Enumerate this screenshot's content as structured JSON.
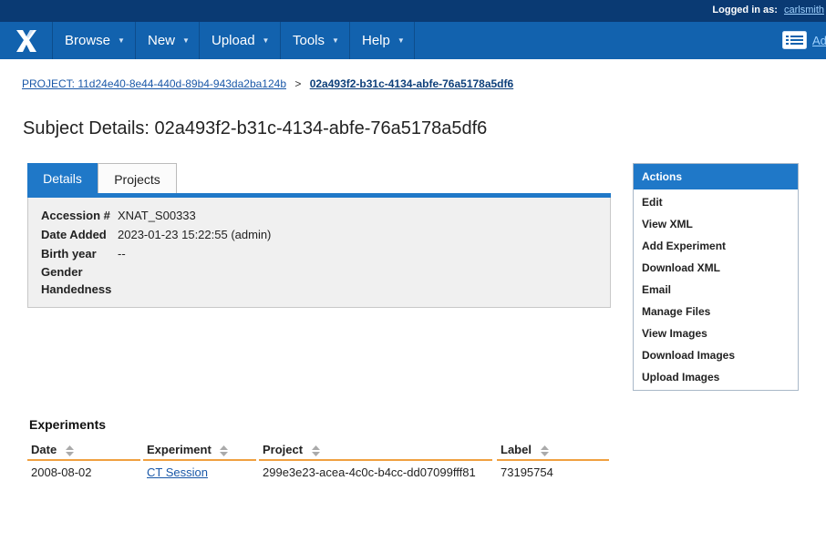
{
  "header": {
    "logged_in_label": "Logged in as:",
    "username": "carlsmith"
  },
  "nav": {
    "items": [
      {
        "label": "Browse"
      },
      {
        "label": "New"
      },
      {
        "label": "Upload"
      },
      {
        "label": "Tools"
      },
      {
        "label": "Help"
      }
    ],
    "right_label": "Ad"
  },
  "breadcrumb": {
    "project": "PROJECT: 11d24e40-8e44-440d-89b4-943da2ba124b",
    "separator": ">",
    "current": "02a493f2-b31c-4134-abfe-76a5178a5df6"
  },
  "page": {
    "title": "Subject Details: 02a493f2-b31c-4134-abfe-76a5178a5df6"
  },
  "tabs": {
    "details": "Details",
    "projects": "Projects"
  },
  "details": [
    {
      "label": "Accession #",
      "value": "XNAT_S00333"
    },
    {
      "label": "Date Added",
      "value": "2023-01-23 15:22:55 (admin)"
    },
    {
      "label": "Birth year",
      "value": "--"
    },
    {
      "label": "Gender",
      "value": ""
    },
    {
      "label": "Handedness",
      "value": ""
    }
  ],
  "actions": {
    "title": "Actions",
    "items": [
      "Edit",
      "View XML",
      "Add Experiment",
      "Download XML",
      "Email",
      "Manage Files",
      "View Images",
      "Download Images",
      "Upload Images"
    ]
  },
  "experiments": {
    "title": "Experiments",
    "columns": [
      "Date",
      "Experiment",
      "Project",
      "Label"
    ],
    "rows": [
      {
        "date": "2008-08-02",
        "experiment": "CT Session",
        "project": "299e3e23-acea-4c0c-b4cc-dd07099fff81",
        "label": "73195754"
      }
    ]
  },
  "colors": {
    "top_strip": "#0a3a73",
    "nav": "#1262ae",
    "accent": "#1f78c8",
    "table_rule": "#f0a040",
    "link": "#1a58a8"
  }
}
